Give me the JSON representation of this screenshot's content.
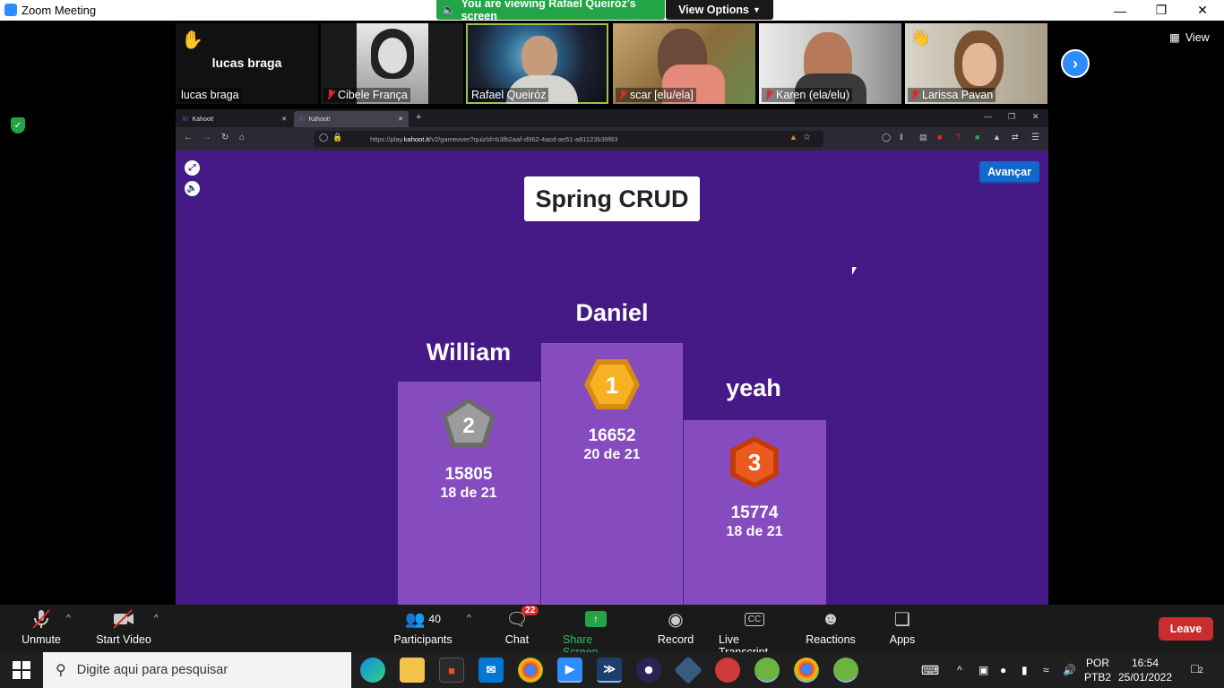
{
  "window": {
    "title": "Zoom Meeting",
    "sharing_banner": "You are viewing Rafael Queiróz's screen",
    "view_options": "View Options",
    "view_label": "View"
  },
  "participants": [
    {
      "name": "lucas braga",
      "big_name": "lucas braga",
      "muted": false,
      "hand_raised": true
    },
    {
      "name": "Cibele França",
      "muted": true
    },
    {
      "name": "Rafael Queiróz",
      "muted": false,
      "active_speaker": true
    },
    {
      "name": "scar [elu/ela]",
      "muted": true
    },
    {
      "name": "Karen (ela/elu)",
      "muted": true
    },
    {
      "name": "Larissa Pavan",
      "muted": true
    }
  ],
  "browser": {
    "tabs": [
      {
        "label": "Kahoot!"
      },
      {
        "label": "Kahoot!"
      }
    ],
    "url_prefix": "https://play.",
    "url_domain": "kahoot.it",
    "url_rest": "/v2/gameover?quizId=b3fb2aaf-d962-4acd-ae51-a81123b39f83"
  },
  "kahoot": {
    "title": "Spring CRUD",
    "next_button": "Avançar",
    "podium": [
      {
        "rank": "1",
        "name": "Daniel",
        "score": "16652",
        "correct": "20 de 21",
        "color": "#f0a020"
      },
      {
        "rank": "2",
        "name": "William",
        "score": "15805",
        "correct": "18 de 21",
        "color": "#8f8f8f"
      },
      {
        "rank": "3",
        "name": "yeah",
        "score": "15774",
        "correct": "18 de 21",
        "color": "#e2531b"
      }
    ]
  },
  "controls": {
    "unmute": "Unmute",
    "start_video": "Start Video",
    "participants": "Participants",
    "participants_count": "40",
    "chat": "Chat",
    "chat_badge": "22",
    "share_screen": "Share Screen",
    "record": "Record",
    "live_transcript": "Live Transcript",
    "reactions": "Reactions",
    "apps": "Apps",
    "leave": "Leave",
    "cc": "CC"
  },
  "taskbar": {
    "search_placeholder": "Digite aqui para pesquisar",
    "lang": "POR",
    "layout": "PTB2",
    "time": "16:54",
    "date": "25/01/2022",
    "notifications": "2"
  }
}
